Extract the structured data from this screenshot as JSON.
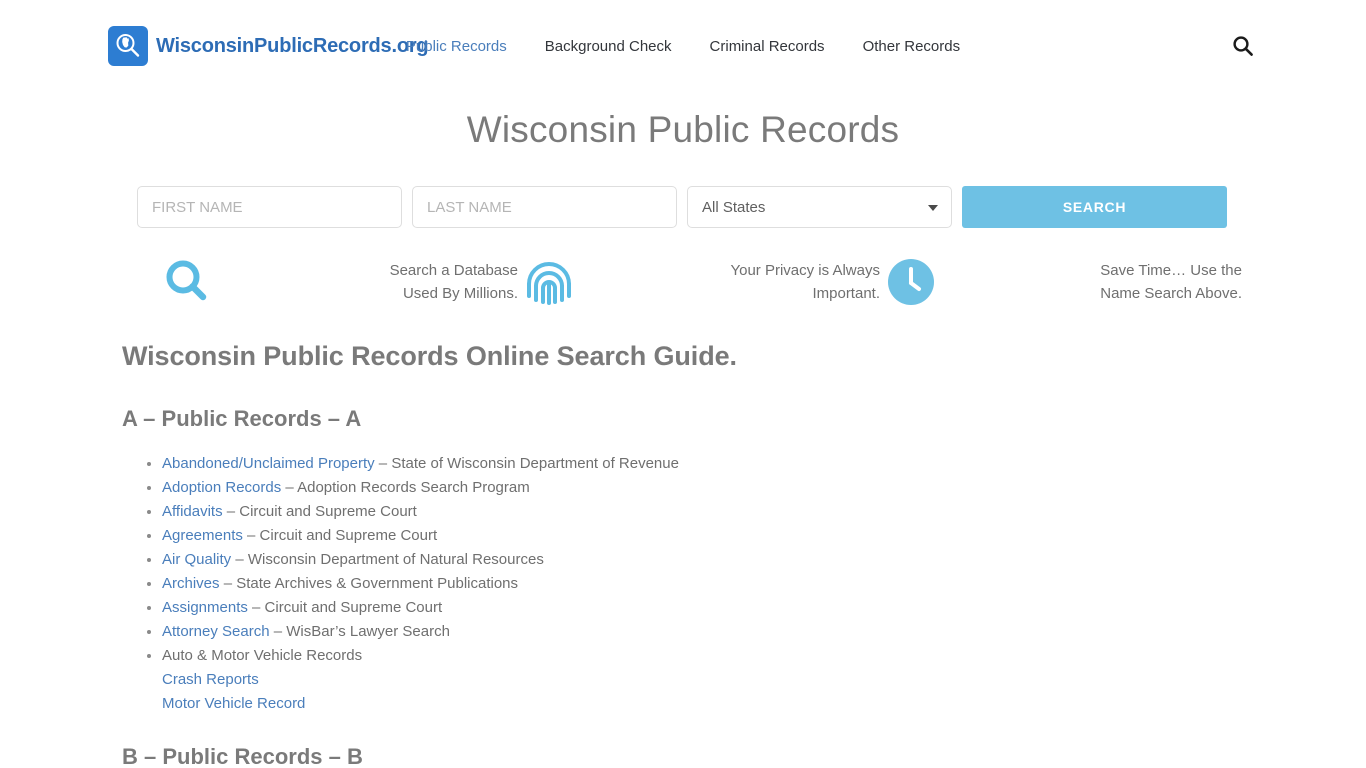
{
  "header": {
    "brand_name": "WisconsinPublicRecords.org",
    "logo_icon": "magnifier-wisconsin-icon",
    "nav": [
      {
        "label": "Public Records",
        "active": true
      },
      {
        "label": "Background Check",
        "active": false
      },
      {
        "label": "Criminal Records",
        "active": false
      },
      {
        "label": "Other Records",
        "active": false
      }
    ],
    "search_icon": "search-icon"
  },
  "hero": {
    "title": "Wisconsin Public Records"
  },
  "search_form": {
    "first_name_placeholder": "FIRST NAME",
    "first_name_value": "",
    "last_name_placeholder": "LAST NAME",
    "last_name_value": "",
    "state_selected": "All States",
    "state_options": [
      "All States"
    ],
    "submit_label": "SEARCH",
    "submit_color": "#6ec1e4"
  },
  "features": [
    {
      "icon": "search-icon",
      "line1": "Search a Database",
      "line2": "Used By Millions."
    },
    {
      "icon": "fingerprint-icon",
      "line1": "Your Privacy is Always",
      "line2": "Important."
    },
    {
      "icon": "clock-icon",
      "line1": "Save Time… Use the",
      "line2": "Name Search Above."
    }
  ],
  "content": {
    "guide_title": "Wisconsin Public Records Online Search Guide.",
    "section_a_title": "A – Public Records – A",
    "section_b_title": "B – Public Records – B",
    "items": [
      {
        "link": "Abandoned/Unclaimed Property",
        "desc": " – State of Wisconsin Department of Revenue"
      },
      {
        "link": "Adoption Records",
        "desc": " – Adoption Records Search Program"
      },
      {
        "link": "Affidavits",
        "desc": " – Circuit and Supreme Court"
      },
      {
        "link": "Agreements",
        "desc": " – Circuit and Supreme Court"
      },
      {
        "link": "Air Quality",
        "desc": " – Wisconsin Department of Natural Resources"
      },
      {
        "link": "Archives",
        "desc": " – State Archives & Government Publications"
      },
      {
        "link": "Assignments",
        "desc": " – Circuit and Supreme Court"
      },
      {
        "link": "Attorney Search",
        "desc": " – WisBar’s Lawyer Search"
      }
    ],
    "auto_item": {
      "text": "Auto & Motor Vehicle Records",
      "sub_links": [
        "Crash Reports",
        "Motor Vehicle Record"
      ]
    }
  },
  "colors": {
    "link": "#4a7ebb",
    "brand": "#2d6cb5",
    "accent": "#6ec1e4",
    "heading": "#7a7a7a",
    "body": "#6f6f6f"
  }
}
